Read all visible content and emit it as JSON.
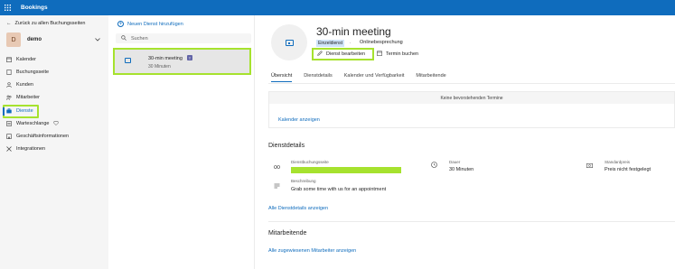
{
  "app": {
    "title": "Bookings"
  },
  "nav": {
    "back_label": "Zurück zu allen Buchungsseiten",
    "account_initial": "D",
    "account_name": "demo",
    "items": [
      {
        "label": "Kalender",
        "icon": "calendar-icon"
      },
      {
        "label": "Buchungsseite",
        "icon": "page-icon"
      },
      {
        "label": "Kunden",
        "icon": "person-icon"
      },
      {
        "label": "Mitarbeiter",
        "icon": "people-icon"
      },
      {
        "label": "Dienste",
        "icon": "briefcase-icon",
        "active": true
      },
      {
        "label": "Warteschlange",
        "icon": "queue-icon"
      },
      {
        "label": "Geschäftsinformationen",
        "icon": "building-icon"
      },
      {
        "label": "Integrationen",
        "icon": "tools-icon"
      }
    ]
  },
  "services": {
    "add_label": "Neuen Dienst hinzufügen",
    "search_placeholder": "Suchen",
    "selected": {
      "name": "30-min meeting",
      "duration": "30 Minuten"
    }
  },
  "detail": {
    "title": "30-min meeting",
    "tag": "Einzeldienst",
    "tag_sep": ".",
    "online": "Onlinebesprechung",
    "edit_label": "Dienst bearbeiten",
    "book_label": "Termin buchen",
    "tabs": [
      "Übersicht",
      "Dienstdetails",
      "Kalender und Verfügbarkeit",
      "Mitarbeitende"
    ],
    "no_appointments": "Keine bevorstehenden Termine",
    "calendar_link": "Kalender anzeigen",
    "details_heading": "Dienstdetails",
    "booking_page_label": "Dienstbuchungsseite",
    "duration_label": "Dauer",
    "duration_value": "30 Minuten",
    "price_label": "Standardpreis",
    "price_value": "Preis nicht festgelegt",
    "description_label": "Beschreibung",
    "description_value": "Grab some time with us for an appointment",
    "all_details_link": "Alle Dienstdetails anzeigen",
    "staff_heading": "Mitarbeitende",
    "all_staff_link": "Alle zugewiesenen Mitarbeiter anzeigen"
  },
  "colors": {
    "brand": "#0f6cbd",
    "highlight": "#a6e22e"
  }
}
